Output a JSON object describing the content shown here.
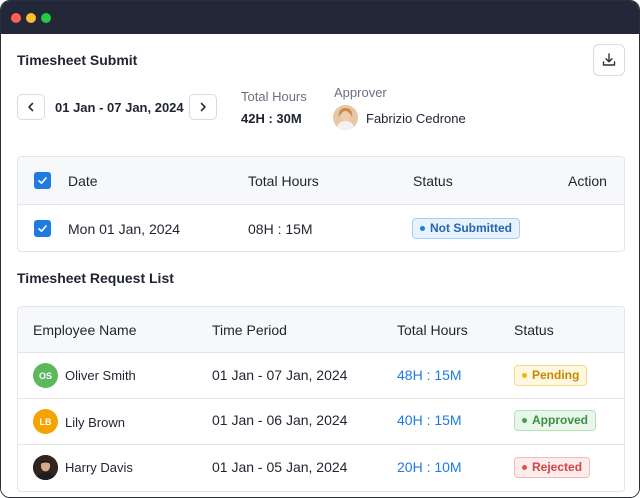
{
  "header": {
    "title": "Timesheet Submit",
    "date_range": "01 Jan - 07 Jan, 2024",
    "total_hours_label": "Total Hours",
    "total_hours_value": "42H : 30M",
    "approver_label": "Approver",
    "approver_name": "Fabrizio Cedrone",
    "icons": {
      "download": "download-icon",
      "prev": "chevron-left-icon",
      "next": "chevron-right-icon"
    }
  },
  "timesheet_table": {
    "columns": [
      "Date",
      "Total Hours",
      "Status",
      "Action"
    ],
    "rows": [
      {
        "checked": true,
        "date": "Mon 01 Jan, 2024",
        "total_hours": "08H : 15M",
        "status": "Not Submitted",
        "status_color": "blue"
      }
    ]
  },
  "request_list": {
    "title": "Timesheet Request List",
    "columns": [
      "Employee Name",
      "Time Period",
      "Total Hours",
      "Status"
    ],
    "rows": [
      {
        "initials": "OS",
        "avatar_color": "#5cb85c",
        "name": "Oliver Smith",
        "period": "01 Jan - 07 Jan, 2024",
        "hours": "48H : 15M",
        "status": "Pending",
        "status_color": "yellow"
      },
      {
        "initials": "LB",
        "avatar_color": "#f4a300",
        "name": "Lily Brown",
        "period": "01 Jan - 06 Jan, 2024",
        "hours": "40H : 15M",
        "status": "Approved",
        "status_color": "green"
      },
      {
        "initials": "",
        "avatar_color": "#3a2a24",
        "name": "Harry Davis",
        "period": "01 Jan - 05 Jan, 2024",
        "hours": "20H : 10M",
        "status": "Rejected",
        "status_color": "red"
      }
    ]
  },
  "colors": {
    "accent": "#1e7be6",
    "titlebar": "#222838",
    "pending": "#f4b400",
    "approved": "#43a047",
    "rejected": "#e05252"
  }
}
